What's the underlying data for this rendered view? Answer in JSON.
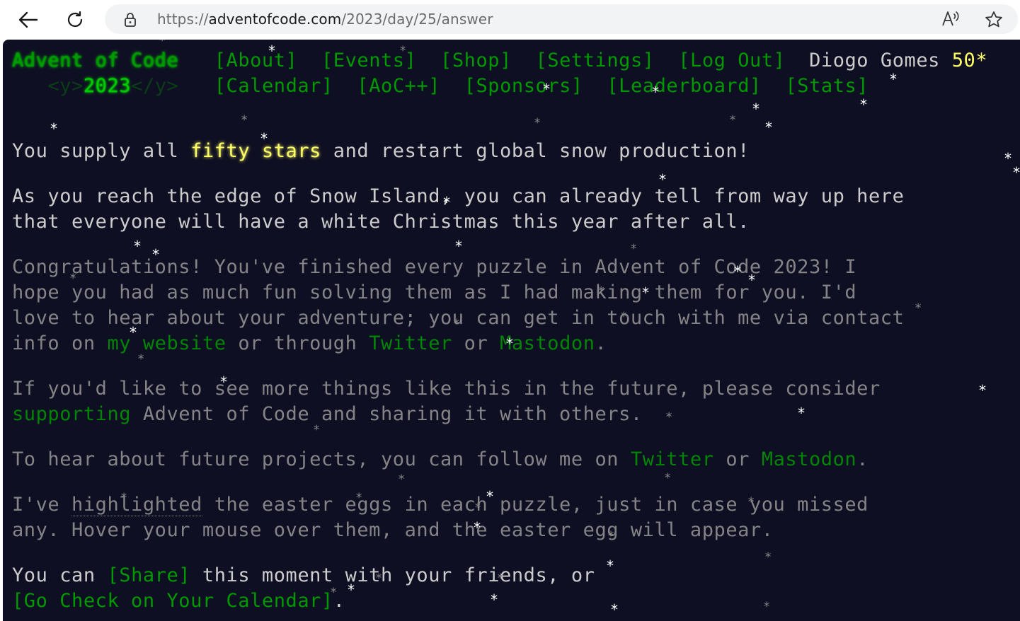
{
  "browser": {
    "url_prefix": "https://",
    "url_host": "adventofcode.com",
    "url_path": "/2023/day/25/answer",
    "icons": {
      "back": "back-arrow-icon",
      "refresh": "refresh-icon",
      "lock": "lock-icon",
      "read_aloud": "read-aloud-icon",
      "favorite": "favorite-star-icon"
    }
  },
  "header": {
    "title": "Advent of Code",
    "nav_row1": [
      "[About]",
      "[Events]",
      "[Shop]",
      "[Settings]",
      "[Log Out]"
    ],
    "user_name": "Diogo Gomes",
    "star_count": "50*",
    "year_open": "<y>",
    "year": "2023",
    "year_close": "</y>",
    "nav_row2": [
      "[Calendar]",
      "[AoC++]",
      "[Sponsors]",
      "[Leaderboard]",
      "[Stats]"
    ]
  },
  "content": {
    "p1": {
      "a": "You supply all ",
      "b": "fifty stars",
      "c": " and restart global snow production!"
    },
    "p2": {
      "line1": "As you reach the edge of Snow Island, you can already tell from way up here",
      "line2": "that everyone will have a white Christmas this year after all."
    },
    "p3": {
      "line1": "Congratulations! You've finished every puzzle in Advent of Code 2023! I",
      "line2": "hope you had as much fun solving them as I had making them for you. I'd",
      "line3": "love to hear about your adventure; you can get in touch with me via contact",
      "line4a": "info on ",
      "link_website": "my website",
      "line4b": " or through ",
      "link_twitter": "Twitter",
      "line4c": " or ",
      "link_mastodon": "Mastodon",
      "line4d": "."
    },
    "p4": {
      "line1": "If you'd like to see more things like this in the future, please consider",
      "link_supporting": "supporting",
      "line2": " Advent of Code and sharing it with others."
    },
    "p5": {
      "a": "To hear about future projects, you can follow me on ",
      "link_twitter": "Twitter",
      "b": " or ",
      "link_mastodon": "Mastodon",
      "c": "."
    },
    "p6": {
      "line1a": "I've ",
      "highlighted": "highlighted",
      "line1b": " the easter eggs in each puzzle, just in case you missed",
      "line2": "any. Hover your mouse over them, and the easter egg will appear."
    },
    "p7": {
      "line1a": "You can ",
      "share": "[Share]",
      "line1b": " this moment with your friends, or",
      "calendar_link": "[Go Check on Your Calendar]",
      "line2b": "."
    }
  },
  "colors": {
    "background": "#0f0f23",
    "text": "#cccccc",
    "link": "#009900",
    "title_green": "#00cc00",
    "star_yellow": "#ffff66"
  }
}
